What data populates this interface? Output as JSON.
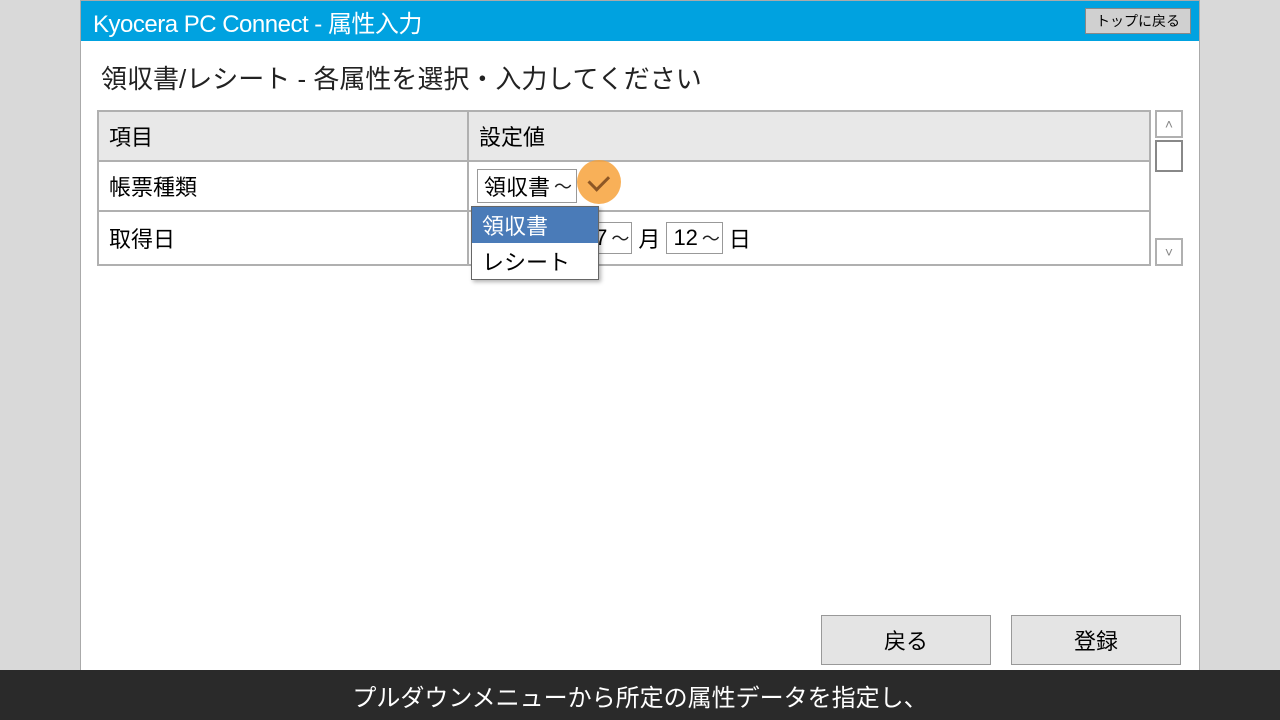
{
  "titlebar": {
    "app_title": "Kyocera PC Connect - 属性入力",
    "top_return": "トップに戻る"
  },
  "instruction": "領収書/レシート - 各属性を選択・入力してください",
  "table": {
    "header_item": "項目",
    "header_value": "設定値",
    "rows": [
      {
        "label": "帳票種類",
        "selected": "領収書",
        "options": [
          "領収書",
          "レシート"
        ]
      },
      {
        "label": "取得日",
        "month_value": "7",
        "month_suffix": "月",
        "day_value": "12",
        "day_suffix": "日"
      }
    ]
  },
  "footer": {
    "back": "戻る",
    "register": "登録"
  },
  "caption": "プルダウンメニューから所定の属性データを指定し、"
}
